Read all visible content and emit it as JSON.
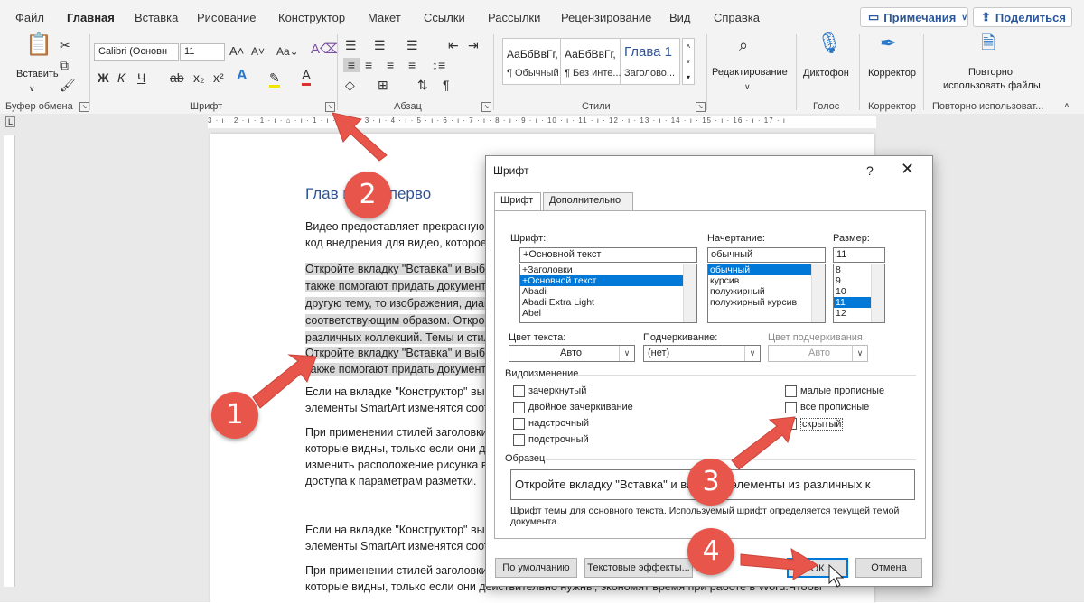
{
  "tabs": [
    "Файл",
    "Главная",
    "Вставка",
    "Рисование",
    "Конструктор",
    "Макет",
    "Ссылки",
    "Рассылки",
    "Рецензирование",
    "Вид",
    "Справка"
  ],
  "top_buttons": {
    "comments": "Примечания",
    "share": "Поделиться"
  },
  "ribbon": {
    "paste_label": "Вставить",
    "clipboard_group": "Буфер обмена",
    "font_name": "Calibri (Основн",
    "font_size": "11",
    "font_group": "Шрифт",
    "paragraph_group": "Абзац",
    "styles_group": "Стили",
    "styles": [
      {
        "sample": "АаБбВвГг,",
        "name": "¶ Обычный"
      },
      {
        "sample": "АаБбВвГг,",
        "name": "¶ Без инте..."
      },
      {
        "sample": "Глава 1",
        "name": "Заголово..."
      }
    ],
    "editing_label": "Редактирование",
    "dictate_label": "Диктофон",
    "voice_group": "Голос",
    "editor_label": "Корректор",
    "editor_group": "Корректор",
    "reuse_label_1": "Повторно",
    "reuse_label_2": "использовать файлы",
    "reuse_group": "Повторно использоват..."
  },
  "ruler_text": "3 · ı · 2 · ı · 1 · ı · ⌂ · ı · 1 · ı · 2 · ı · 3 · ı · 4 · ı · 5 · ı · 6 · ı · 7 · ı · 8 · ı · 9 · ı · 10 · ı · 11 · ı · 12 · ı · 13 · ı · 14 · ı · 15 · ı · 16 · ı · 17 · ı",
  "document": {
    "heading": "Глав       вание перво",
    "lines": [
      "Видео предоставляет прекрасную в",
      "код внедрения для видео, которое",
      "Откройте вкладку \"Вставка\" и выбе",
      "также помогают придать документ",
      "другую тему, то изображения, диаг",
      "соответствующим образом. Открой",
      "различных коллекций. Темы и стил",
      "Откройте вкладку \"Вставка\" и выбе",
      "также помогают придать документ",
      "Если на вкладке \"Конструктор\" выб",
      "элементы SmartArt изменятся соот",
      "При применении стилей заголовки",
      "которые видны, только если они д",
      "изменить расположение рисунка в",
      "доступа к параметрам разметки.",
      "Если на вкладке \"Конструктор\" выб",
      "элементы SmartArt изменятся соот",
      "При применении стилей заголовки",
      "которые видны, только если они действительно нужны, экономят время при работе в Word.Чтобы"
    ]
  },
  "dialog": {
    "title": "Шрифт",
    "help": "?",
    "close": "✕",
    "tab_font": "Шрифт",
    "tab_advanced": "Дополнительно",
    "font_label": "Шрифт:",
    "font_value": "+Основной текст",
    "font_list": [
      "+Заголовки",
      "+Основной текст",
      "Abadi",
      "Abadi Extra Light",
      "Abel"
    ],
    "style_label": "Начертание:",
    "style_value": "обычный",
    "style_list": [
      "обычный",
      "курсив",
      "полужирный",
      "полужирный курсив"
    ],
    "size_label": "Размер:",
    "size_value": "11",
    "size_list": [
      "8",
      "9",
      "10",
      "11",
      "12"
    ],
    "color_label": "Цвет текста:",
    "color_value": "Авто",
    "underline_label": "Подчеркивание:",
    "underline_value": "(нет)",
    "underline_color_label": "Цвет подчеркивания:",
    "underline_color_value": "Авто",
    "effects_label": "Видоизменение",
    "effects_left": [
      "зачеркнутый",
      "двойное зачеркивание",
      "надстрочный",
      "подстрочный"
    ],
    "effects_right": [
      "малые прописные",
      "все прописные",
      "скрытый"
    ],
    "preview_label": "Образец",
    "preview_text": "Откройте вкладку \"Вставка\" и вы       жные элементы из различных к",
    "description": "Шрифт темы для основного текста. Используемый шрифт определяется текущей темой документа.",
    "btn_default": "По умолчанию",
    "btn_effects": "Текстовые эффекты...",
    "btn_ok": "ОК",
    "btn_cancel": "Отмена"
  },
  "badges": [
    "1",
    "2",
    "3",
    "4"
  ],
  "colors": {
    "accent": "#2b579a",
    "badge": "#e8554a",
    "selection": "#0078d7"
  }
}
